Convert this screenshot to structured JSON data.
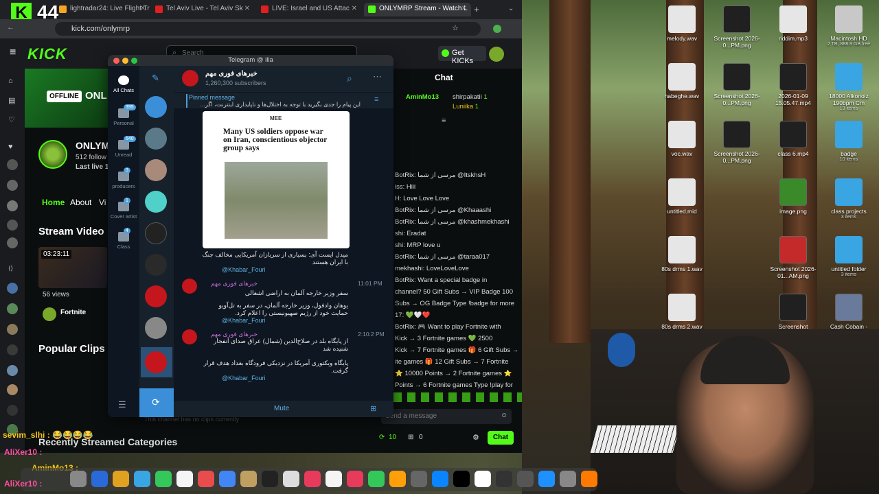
{
  "overlay": {
    "kick_counter": "44",
    "kick_letter": "K"
  },
  "browser": {
    "tabs": [
      {
        "label": "lightradar24: Live Flight Tr",
        "color": "#f5a623"
      },
      {
        "label": "Tel Aviv Live - Tel Aviv Sk",
        "color": "#e02020"
      },
      {
        "label": "LIVE: Israel and US Attac",
        "color": "#e02020"
      },
      {
        "label": "ONLYMRP Stream - Watch L",
        "color": "#53fc18"
      }
    ],
    "url": "kick.com/onlymrp"
  },
  "kick": {
    "logo": "KICK",
    "get_kicks": "Get KICKs",
    "search_placeholder": "Search",
    "offline": "OFFLINE",
    "channel_partial": "ONL",
    "channel_name": "ONLYM",
    "followers": "512 follow",
    "last_live": "Last live 17",
    "nav": {
      "home": "Home",
      "about": "About",
      "videos": "Vi"
    },
    "stream_videos": "Stream Video",
    "video_time": "03:23:11",
    "views": "56 views",
    "fortnite": "Fortnite",
    "popular_clips": "Popular Clips",
    "no_clips": "This channel has no clips currently",
    "recently": "Recently Streamed Categories"
  },
  "chat": {
    "title": "Chat",
    "top_users": [
      {
        "name": "AminMo13",
        "count": ""
      },
      {
        "name": "shirpakatii",
        "count": "1"
      },
      {
        "name": "Luniika",
        "count": "1"
      }
    ],
    "messages": [
      "BotRix: مرسی از شما @ItskhsH",
      "iss: Hiii",
      "H: Love Love Love",
      "BotRix: مرسی از شما @Khaaashi",
      "BotRix: مرسی از شما @khashmekhashi",
      "shi: Eradat",
      "shi: MRP love u",
      "BotRix: مرسی از شما @taraa017",
      "mekhashi: LoveLoveLove",
      "BotRix: Want a special badge in",
      "channel? 50 Gift Subs → VIP Badge 100",
      "Subs → OG Badge Type !badge for more",
      "17: 💚🤍❤️",
      "BotRix: 🎮 Want to play Fortnite with",
      "Kick → 3 Fortnite games 💚 2500",
      "Kick → 7 Fortnite games 🎁 6 Gift Subs →",
      "ite games 🎁 12 Gift Subs → 7 Fortnite",
      "⭐ 10000 Points → 2 Fortnite games ⭐",
      "Points → 6 Fortnite games Type !play for"
    ],
    "input_placeholder": "Send a message",
    "points": "10",
    "gifts": "0",
    "chat_button": "Chat"
  },
  "stream_overlay": {
    "chat1_user": "sevim_slhi :",
    "chat1_text": "😂😂😂😂",
    "chat2_user": "AliXer10 :",
    "chat3_user": "AminMo13 :",
    "chat4_user": "AliXer10 :"
  },
  "telegram": {
    "window_title": "Telegram @ illa",
    "folders": [
      {
        "label": "All Chats",
        "badge": ""
      },
      {
        "label": "Personal",
        "badge": "395"
      },
      {
        "label": "Unread",
        "badge": "640"
      },
      {
        "label": "producers",
        "badge": "3"
      },
      {
        "label": "Cover artist",
        "badge": "1"
      },
      {
        "label": "Class",
        "badge": "4"
      }
    ],
    "channel": {
      "name": "خبرهای فوری مهم",
      "subscribers": "1,260,300 subscribers"
    },
    "pinned": {
      "title": "Pinned message",
      "text": "این پیام را جدی بگیرید با توجه به اختلال‌ها و ناپایداری اینترنت، اگر..."
    },
    "article": {
      "source": "MEE",
      "headline": "Many US soldiers oppose war on Iran, conscientious objector group says"
    },
    "post1": {
      "text": "میدل ایست آی: بسیاری از سربازان آمریکایی مخالف جنگ با ایران هستند",
      "link": "@Khabar_Fouri"
    },
    "post2": {
      "sender": "خبرهای فوری مهم",
      "time": "11:01 PM",
      "text1": "سفر وزیر خارجه آلمان به اراضی اشغالی",
      "text2": "یوهان وادفول، وزیر خارجه آلمان، در سفر به تل‌آویو حمایت خود از رژیم صهیونیستی را اعلام کرد.",
      "link": "@Khabar_Fouri"
    },
    "post3": {
      "sender": "خبرهای فوری مهم",
      "time": "2:10:2 PM",
      "text1": "از پایگاه بلد در صلاح‌الدین (شمال) عراق صدای انفجار شنیده شد",
      "text2": "پایگاه ویکتوری آمریکا در نزدیکی فرودگاه بغداد هدف قرار گرفت.",
      "link": "@Khabar_Fouri"
    },
    "mute": "Mute"
  },
  "desktop": {
    "icons": [
      {
        "label": "melody.wav",
        "sub": "",
        "kind": "file"
      },
      {
        "label": "Screenshot 2026-0...PM.png",
        "sub": "",
        "kind": "shot"
      },
      {
        "label": "riddim.mp3",
        "sub": "",
        "kind": "file"
      },
      {
        "label": "Macintosh HD",
        "sub": "2 TB, 888.9 GB free",
        "kind": "drive"
      },
      {
        "label": "nabeghe.wav",
        "sub": "",
        "kind": "file"
      },
      {
        "label": "Screenshot 2026-0...PM.png",
        "sub": "",
        "kind": "shot"
      },
      {
        "label": "2026-01-09 15.05.47.mp4",
        "sub": "",
        "kind": "shot"
      },
      {
        "label": "18000 Alkonoiz 190bpm Cm",
        "sub": "13 items",
        "kind": "folder"
      },
      {
        "label": "voc.wav",
        "sub": "",
        "kind": "file"
      },
      {
        "label": "Screenshot 2026-0...PM.png",
        "sub": "",
        "kind": "shot"
      },
      {
        "label": "class 6.mp4",
        "sub": "",
        "kind": "shot"
      },
      {
        "label": "badge",
        "sub": "10 items",
        "kind": "folder"
      },
      {
        "label": "untitled.mid",
        "sub": "",
        "kind": "file"
      },
      {
        "label": "image.png",
        "sub": "",
        "kind": "image"
      },
      {
        "label": "class projects",
        "sub": "3 items",
        "kind": "folder"
      },
      {
        "label": "80s drms 1.wav",
        "sub": "",
        "kind": "file"
      },
      {
        "label": "Screenshot 2026-01...AM.png",
        "sub": "",
        "kind": "red"
      },
      {
        "label": "untitled folder",
        "sub": "3 items",
        "kind": "folder"
      },
      {
        "label": "80s drms 2.wav",
        "sub": "",
        "kind": "file"
      },
      {
        "label": "Screenshot",
        "sub": "",
        "kind": "shot"
      },
      {
        "label": "Cash Cobain -",
        "sub": "",
        "kind": "photo"
      }
    ]
  }
}
